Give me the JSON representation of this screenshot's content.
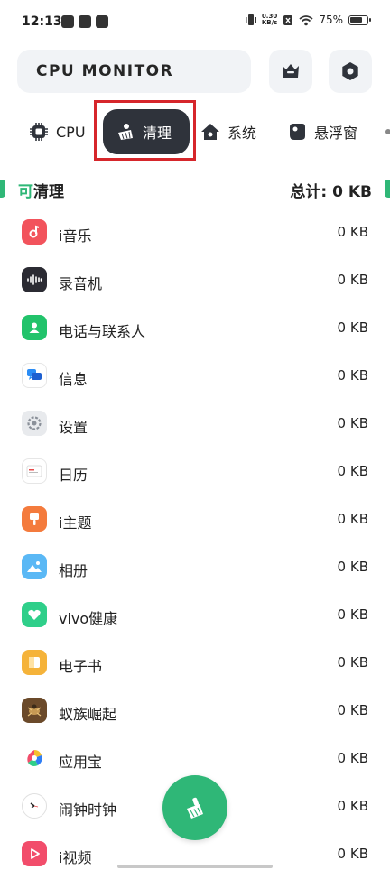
{
  "status_bar": {
    "time": "12:13",
    "net_speed_value": "0.30",
    "net_speed_unit": "KB/s",
    "battery": "75%"
  },
  "header": {
    "title": "CPU MONITOR",
    "crown_icon": "crown-icon",
    "settings_icon": "settings-icon"
  },
  "tabs": [
    {
      "label": "CPU",
      "icon": "chip-icon"
    },
    {
      "label": "清理",
      "icon": "broom-icon",
      "selected": true
    },
    {
      "label": "系统",
      "icon": "home-icon"
    },
    {
      "label": "悬浮窗",
      "icon": "float-window-icon"
    }
  ],
  "section": {
    "title_accent": "可",
    "title_rest": "清理",
    "total": "总计: 0 KB"
  },
  "apps": [
    {
      "name": "i音乐",
      "size": "0 KB",
      "icon": "music-icon",
      "color": "#f2535c"
    },
    {
      "name": "录音机",
      "size": "0 KB",
      "icon": "recorder-icon",
      "color": "#2b2b33"
    },
    {
      "name": "电话与联系人",
      "size": "0 KB",
      "icon": "contacts-icon",
      "color": "#22c36b"
    },
    {
      "name": "信息",
      "size": "0 KB",
      "icon": "message-icon",
      "color": "#2a8cf5"
    },
    {
      "name": "设置",
      "size": "0 KB",
      "icon": "settings-gear-icon",
      "color": "#9aa0a8"
    },
    {
      "name": "日历",
      "size": "0 KB",
      "icon": "calendar-icon",
      "color": "#e74c4c"
    },
    {
      "name": "i主题",
      "size": "0 KB",
      "icon": "theme-icon",
      "color": "#f47b3d"
    },
    {
      "name": "相册",
      "size": "0 KB",
      "icon": "gallery-icon",
      "color": "#3ba7f0"
    },
    {
      "name": "vivo健康",
      "size": "0 KB",
      "icon": "health-icon",
      "color": "#2fcf8a"
    },
    {
      "name": "电子书",
      "size": "0 KB",
      "icon": "ebook-icon",
      "color": "#f5b33a"
    },
    {
      "name": "蚁族崛起",
      "size": "0 KB",
      "icon": "game-icon",
      "color": "#6b4a2a"
    },
    {
      "name": "应用宝",
      "size": "0 KB",
      "icon": "app-store-icon",
      "color": "#2f7ef5"
    },
    {
      "name": "闹钟时钟",
      "size": "0 KB",
      "icon": "clock-icon",
      "color": "#ffffff"
    },
    {
      "name": "i视频",
      "size": "0 KB",
      "icon": "video-icon",
      "color": "#f24d6b"
    }
  ],
  "fab": {
    "icon": "broom-icon",
    "color": "#2fb777"
  }
}
